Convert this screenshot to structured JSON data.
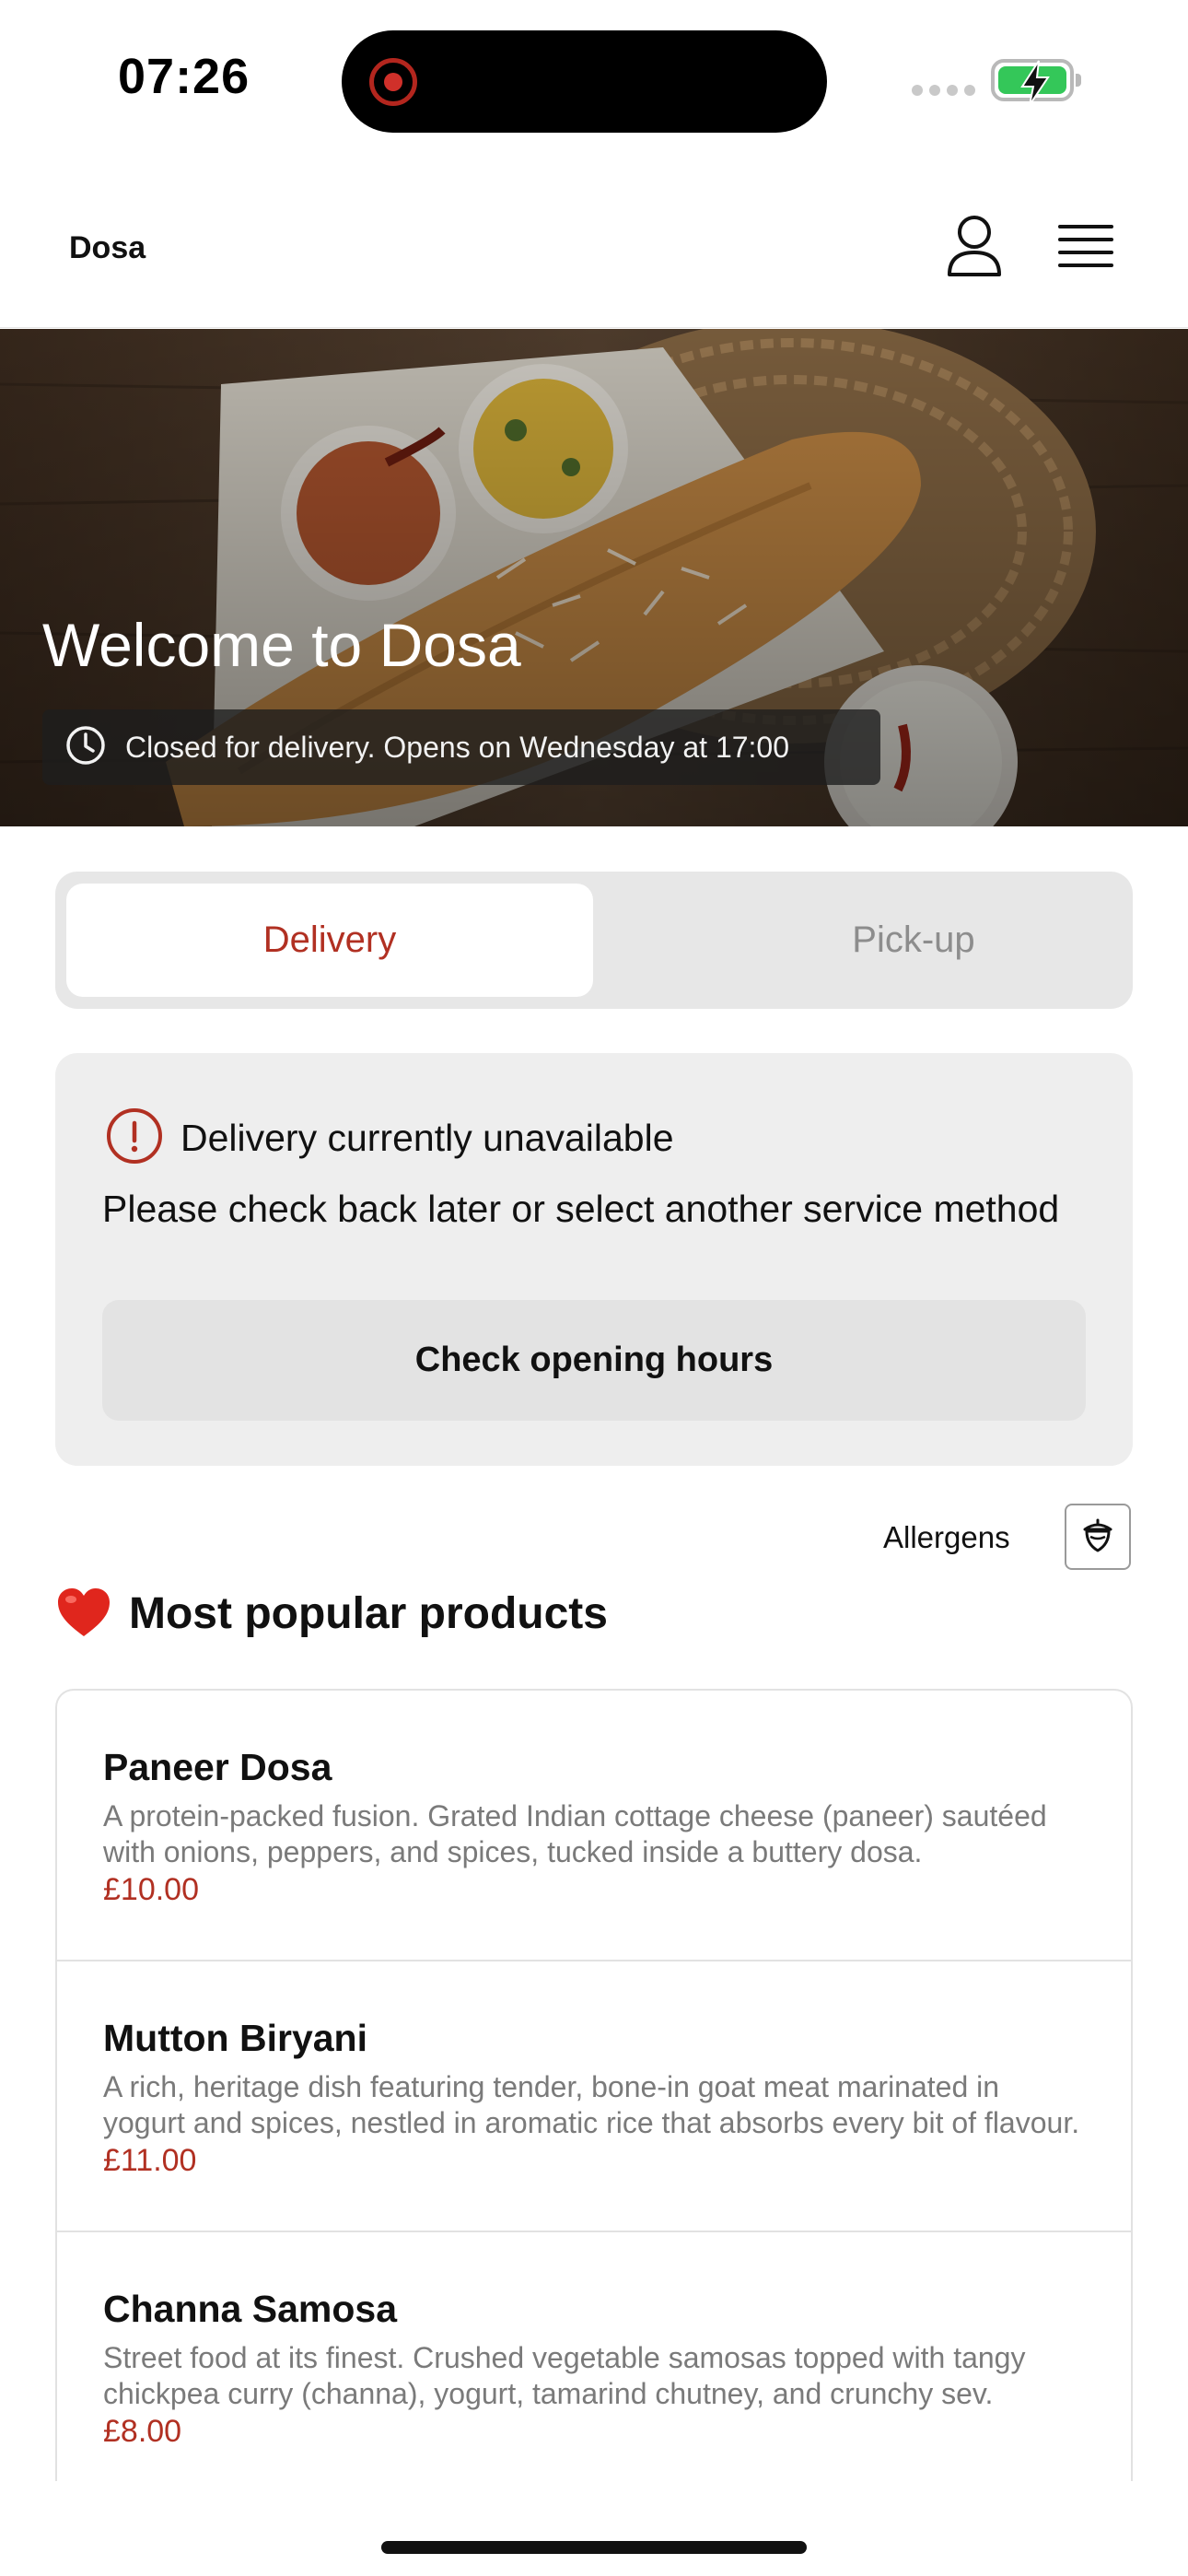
{
  "status_bar": {
    "time": "07:26"
  },
  "header": {
    "brand": "Dosa",
    "icons": [
      "user-icon",
      "menu-icon"
    ]
  },
  "hero": {
    "title": "Welcome to Dosa",
    "status": "Closed for delivery. Opens on Wednesday at 17:00",
    "status_icon": "clock-icon"
  },
  "service_tabs": {
    "selected": "Delivery",
    "options": [
      "Delivery",
      "Pick-up"
    ]
  },
  "notice": {
    "icon": "info-icon",
    "title": "Delivery currently unavailable",
    "body": "Please check back later or select another service method",
    "button": "Check opening hours"
  },
  "allergens": {
    "label": "Allergens",
    "icon": "acorn-icon"
  },
  "popular": {
    "title": "Most popular products",
    "icon": "heart-icon",
    "products": [
      {
        "name": "Paneer Dosa",
        "description": "A protein-packed fusion. Grated Indian cottage cheese (paneer) sautéed with onions, peppers, and spices, tucked inside a buttery dosa.",
        "price": "£10.00"
      },
      {
        "name": "Mutton Biryani",
        "description": "A rich, heritage dish featuring tender, bone-in goat meat marinated in yogurt and spices, nestled in aromatic rice that absorbs every bit of flavour.",
        "price": "£11.00"
      },
      {
        "name": "Channa Samosa",
        "description": "Street food at its finest. Crushed vegetable samosas topped with tangy chickpea curry (channa), yogurt, tamarind chutney, and crunchy sev.",
        "price": "£8.00"
      }
    ]
  },
  "colors": {
    "accent": "#b13022",
    "battery": "#34c759",
    "panel": "#eeeeee"
  }
}
